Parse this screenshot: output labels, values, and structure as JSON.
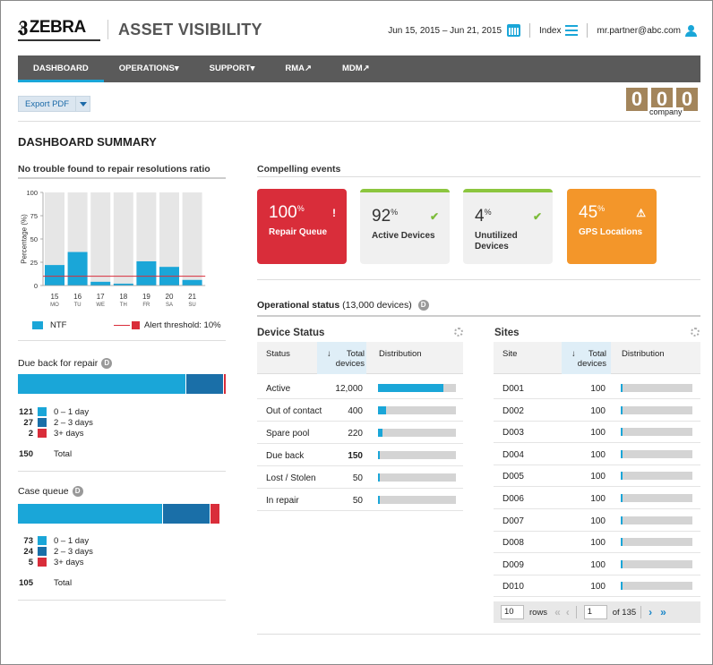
{
  "header": {
    "brand": "ZEBRA",
    "app_title": "ASSET VISIBILITY",
    "date_range": "Jun 15, 2015 – Jun 21, 2015",
    "index_label": "Index",
    "user_email": "mr.partner@abc.com"
  },
  "nav": [
    "DASHBOARD",
    "OPERATIONS▾",
    "SUPPORT▾",
    "RMA↗",
    "MDM↗"
  ],
  "toolbar": {
    "export_label": "Export PDF"
  },
  "counter": {
    "digits": [
      "0",
      "0",
      "0"
    ],
    "label": "company"
  },
  "page_title": "DASHBOARD SUMMARY",
  "ntf_section": {
    "title": "No trouble found to repair resolutions ratio",
    "ylabel": "Percentage (%)",
    "legend_ntf": "NTF",
    "legend_alert": "Alert threshold: 10%"
  },
  "chart_data": {
    "type": "bar",
    "title": "No trouble found to repair resolutions ratio",
    "ylabel": "Percentage (%)",
    "categories": [
      "15",
      "16",
      "17",
      "18",
      "19",
      "20",
      "21"
    ],
    "days": [
      "MO",
      "TU",
      "WE",
      "TH",
      "FR",
      "SA",
      "SU"
    ],
    "values": [
      22,
      36,
      4,
      2,
      26,
      20,
      6
    ],
    "background_values": [
      100,
      100,
      100,
      100,
      100,
      100,
      100
    ],
    "threshold": 10,
    "ylim": [
      0,
      100
    ],
    "yticks": [
      "100",
      "75",
      "50",
      "25",
      "0"
    ],
    "series": [
      {
        "name": "NTF",
        "values": [
          22,
          36,
          4,
          2,
          26,
          20,
          6
        ],
        "color": "#1aa6d8"
      }
    ],
    "threshold_color": "#d92d3a"
  },
  "due_back": {
    "title": "Due back for repair",
    "rows": [
      {
        "n": "121",
        "label": "0 – 1 day",
        "color": "#1aa6d8"
      },
      {
        "n": "27",
        "label": "2 – 3 days",
        "color": "#1a6fa8"
      },
      {
        "n": "2",
        "label": "3+ days",
        "color": "#d92d3a"
      }
    ],
    "total_n": "150",
    "total_label": "Total",
    "fractions": [
      0.806,
      0.18,
      0.014
    ]
  },
  "case_queue": {
    "title": "Case queue",
    "rows": [
      {
        "n": "73",
        "label": "0 – 1 day",
        "color": "#1aa6d8"
      },
      {
        "n": "24",
        "label": "2 – 3 days",
        "color": "#1a6fa8"
      },
      {
        "n": "5",
        "label": "3+ days",
        "color": "#d92d3a"
      }
    ],
    "total_n": "105",
    "total_label": "Total",
    "fractions": [
      0.695,
      0.229,
      0.048
    ]
  },
  "compelling": {
    "title": "Compelling events",
    "cards": [
      {
        "pct": "100",
        "sup": "%",
        "label": "Repair Queue",
        "icon": "!"
      },
      {
        "pct": "92",
        "sup": "%",
        "label": "Active Devices",
        "icon": "✔"
      },
      {
        "pct": "4",
        "sup": "%",
        "label": "Unutilized Devices",
        "icon": "✔"
      },
      {
        "pct": "45",
        "sup": "%",
        "label": "GPS Locations",
        "icon": "⚠"
      }
    ]
  },
  "operational": {
    "title": "Operational status",
    "count": "(13,000 devices)"
  },
  "device_status": {
    "title": "Device Status",
    "cols": [
      "Status",
      "Total devices",
      "Distribution"
    ],
    "rows": [
      {
        "status": "Active",
        "total": "12,000",
        "frac": 0.84
      },
      {
        "status": "Out of contact",
        "total": "400",
        "frac": 0.1
      },
      {
        "status": "Spare pool",
        "total": "220",
        "frac": 0.06
      },
      {
        "status": "Due back",
        "total": "150",
        "frac": 0.02
      },
      {
        "status": "Lost / Stolen",
        "total": "50",
        "frac": 0.01
      },
      {
        "status": "In repair",
        "total": "50",
        "frac": 0.01
      }
    ]
  },
  "sites": {
    "title": "Sites",
    "cols": [
      "Site",
      "Total devices",
      "Distribution"
    ],
    "rows": [
      {
        "site": "D001",
        "total": "100"
      },
      {
        "site": "D002",
        "total": "100"
      },
      {
        "site": "D003",
        "total": "100"
      },
      {
        "site": "D004",
        "total": "100"
      },
      {
        "site": "D005",
        "total": "100"
      },
      {
        "site": "D006",
        "total": "100"
      },
      {
        "site": "D007",
        "total": "100"
      },
      {
        "site": "D008",
        "total": "100"
      },
      {
        "site": "D009",
        "total": "100"
      },
      {
        "site": "D010",
        "total": "100"
      }
    ],
    "pager": {
      "rows_value": "10",
      "rows_label": "rows",
      "page_value": "1",
      "of_label": "of 135"
    }
  }
}
